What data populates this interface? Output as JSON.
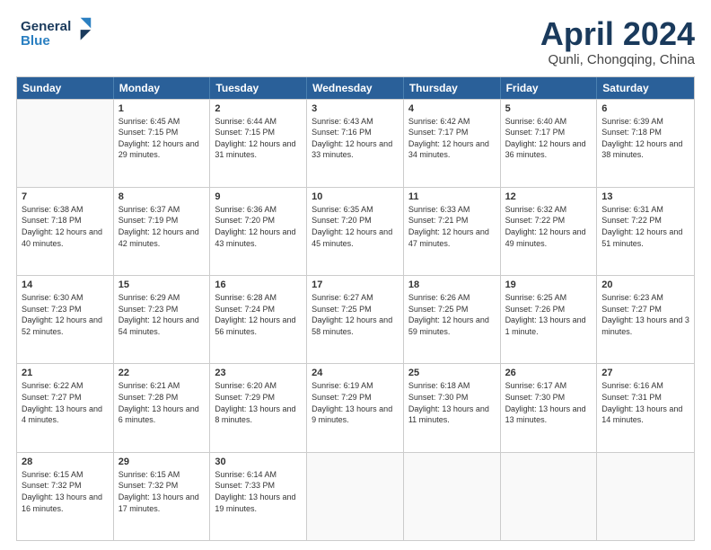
{
  "header": {
    "logo_line1": "General",
    "logo_line2": "Blue",
    "title": "April 2024",
    "subtitle": "Qunli, Chongqing, China"
  },
  "days_of_week": [
    "Sunday",
    "Monday",
    "Tuesday",
    "Wednesday",
    "Thursday",
    "Friday",
    "Saturday"
  ],
  "weeks": [
    [
      {
        "num": "",
        "sunrise": "",
        "sunset": "",
        "daylight": ""
      },
      {
        "num": "1",
        "sunrise": "Sunrise: 6:45 AM",
        "sunset": "Sunset: 7:15 PM",
        "daylight": "Daylight: 12 hours and 29 minutes."
      },
      {
        "num": "2",
        "sunrise": "Sunrise: 6:44 AM",
        "sunset": "Sunset: 7:15 PM",
        "daylight": "Daylight: 12 hours and 31 minutes."
      },
      {
        "num": "3",
        "sunrise": "Sunrise: 6:43 AM",
        "sunset": "Sunset: 7:16 PM",
        "daylight": "Daylight: 12 hours and 33 minutes."
      },
      {
        "num": "4",
        "sunrise": "Sunrise: 6:42 AM",
        "sunset": "Sunset: 7:17 PM",
        "daylight": "Daylight: 12 hours and 34 minutes."
      },
      {
        "num": "5",
        "sunrise": "Sunrise: 6:40 AM",
        "sunset": "Sunset: 7:17 PM",
        "daylight": "Daylight: 12 hours and 36 minutes."
      },
      {
        "num": "6",
        "sunrise": "Sunrise: 6:39 AM",
        "sunset": "Sunset: 7:18 PM",
        "daylight": "Daylight: 12 hours and 38 minutes."
      }
    ],
    [
      {
        "num": "7",
        "sunrise": "Sunrise: 6:38 AM",
        "sunset": "Sunset: 7:18 PM",
        "daylight": "Daylight: 12 hours and 40 minutes."
      },
      {
        "num": "8",
        "sunrise": "Sunrise: 6:37 AM",
        "sunset": "Sunset: 7:19 PM",
        "daylight": "Daylight: 12 hours and 42 minutes."
      },
      {
        "num": "9",
        "sunrise": "Sunrise: 6:36 AM",
        "sunset": "Sunset: 7:20 PM",
        "daylight": "Daylight: 12 hours and 43 minutes."
      },
      {
        "num": "10",
        "sunrise": "Sunrise: 6:35 AM",
        "sunset": "Sunset: 7:20 PM",
        "daylight": "Daylight: 12 hours and 45 minutes."
      },
      {
        "num": "11",
        "sunrise": "Sunrise: 6:33 AM",
        "sunset": "Sunset: 7:21 PM",
        "daylight": "Daylight: 12 hours and 47 minutes."
      },
      {
        "num": "12",
        "sunrise": "Sunrise: 6:32 AM",
        "sunset": "Sunset: 7:22 PM",
        "daylight": "Daylight: 12 hours and 49 minutes."
      },
      {
        "num": "13",
        "sunrise": "Sunrise: 6:31 AM",
        "sunset": "Sunset: 7:22 PM",
        "daylight": "Daylight: 12 hours and 51 minutes."
      }
    ],
    [
      {
        "num": "14",
        "sunrise": "Sunrise: 6:30 AM",
        "sunset": "Sunset: 7:23 PM",
        "daylight": "Daylight: 12 hours and 52 minutes."
      },
      {
        "num": "15",
        "sunrise": "Sunrise: 6:29 AM",
        "sunset": "Sunset: 7:23 PM",
        "daylight": "Daylight: 12 hours and 54 minutes."
      },
      {
        "num": "16",
        "sunrise": "Sunrise: 6:28 AM",
        "sunset": "Sunset: 7:24 PM",
        "daylight": "Daylight: 12 hours and 56 minutes."
      },
      {
        "num": "17",
        "sunrise": "Sunrise: 6:27 AM",
        "sunset": "Sunset: 7:25 PM",
        "daylight": "Daylight: 12 hours and 58 minutes."
      },
      {
        "num": "18",
        "sunrise": "Sunrise: 6:26 AM",
        "sunset": "Sunset: 7:25 PM",
        "daylight": "Daylight: 12 hours and 59 minutes."
      },
      {
        "num": "19",
        "sunrise": "Sunrise: 6:25 AM",
        "sunset": "Sunset: 7:26 PM",
        "daylight": "Daylight: 13 hours and 1 minute."
      },
      {
        "num": "20",
        "sunrise": "Sunrise: 6:23 AM",
        "sunset": "Sunset: 7:27 PM",
        "daylight": "Daylight: 13 hours and 3 minutes."
      }
    ],
    [
      {
        "num": "21",
        "sunrise": "Sunrise: 6:22 AM",
        "sunset": "Sunset: 7:27 PM",
        "daylight": "Daylight: 13 hours and 4 minutes."
      },
      {
        "num": "22",
        "sunrise": "Sunrise: 6:21 AM",
        "sunset": "Sunset: 7:28 PM",
        "daylight": "Daylight: 13 hours and 6 minutes."
      },
      {
        "num": "23",
        "sunrise": "Sunrise: 6:20 AM",
        "sunset": "Sunset: 7:29 PM",
        "daylight": "Daylight: 13 hours and 8 minutes."
      },
      {
        "num": "24",
        "sunrise": "Sunrise: 6:19 AM",
        "sunset": "Sunset: 7:29 PM",
        "daylight": "Daylight: 13 hours and 9 minutes."
      },
      {
        "num": "25",
        "sunrise": "Sunrise: 6:18 AM",
        "sunset": "Sunset: 7:30 PM",
        "daylight": "Daylight: 13 hours and 11 minutes."
      },
      {
        "num": "26",
        "sunrise": "Sunrise: 6:17 AM",
        "sunset": "Sunset: 7:30 PM",
        "daylight": "Daylight: 13 hours and 13 minutes."
      },
      {
        "num": "27",
        "sunrise": "Sunrise: 6:16 AM",
        "sunset": "Sunset: 7:31 PM",
        "daylight": "Daylight: 13 hours and 14 minutes."
      }
    ],
    [
      {
        "num": "28",
        "sunrise": "Sunrise: 6:15 AM",
        "sunset": "Sunset: 7:32 PM",
        "daylight": "Daylight: 13 hours and 16 minutes."
      },
      {
        "num": "29",
        "sunrise": "Sunrise: 6:15 AM",
        "sunset": "Sunset: 7:32 PM",
        "daylight": "Daylight: 13 hours and 17 minutes."
      },
      {
        "num": "30",
        "sunrise": "Sunrise: 6:14 AM",
        "sunset": "Sunset: 7:33 PM",
        "daylight": "Daylight: 13 hours and 19 minutes."
      },
      {
        "num": "",
        "sunrise": "",
        "sunset": "",
        "daylight": ""
      },
      {
        "num": "",
        "sunrise": "",
        "sunset": "",
        "daylight": ""
      },
      {
        "num": "",
        "sunrise": "",
        "sunset": "",
        "daylight": ""
      },
      {
        "num": "",
        "sunrise": "",
        "sunset": "",
        "daylight": ""
      }
    ]
  ]
}
